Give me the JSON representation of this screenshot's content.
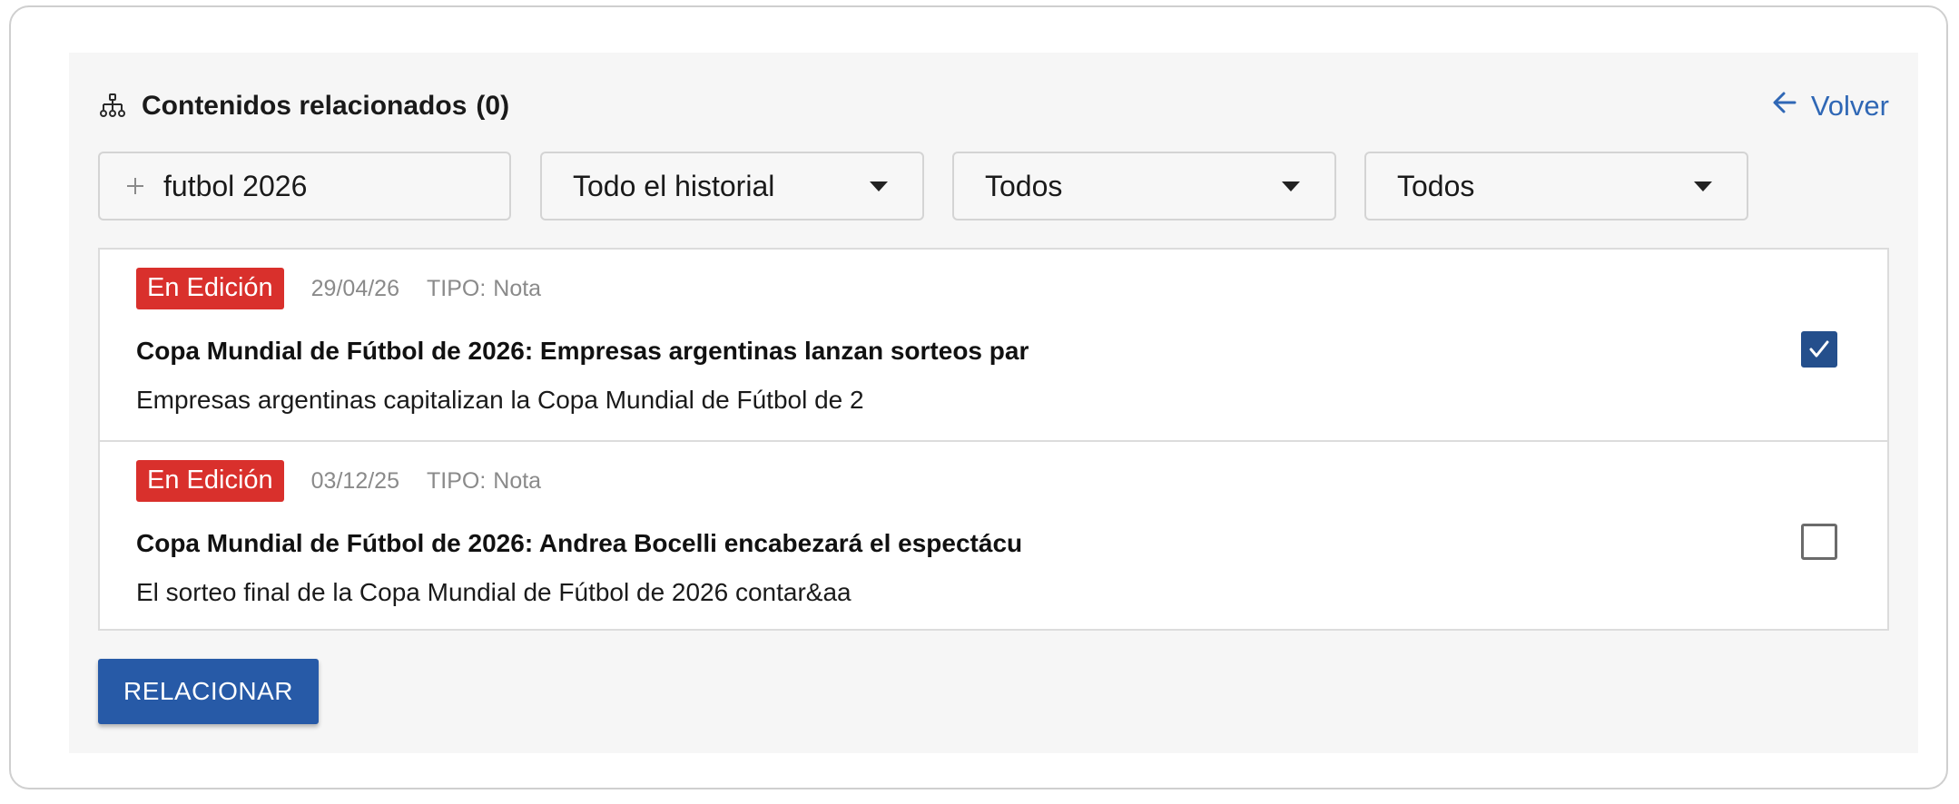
{
  "header": {
    "title": "Contenidos relacionados",
    "count": "(0)",
    "back_label": "Volver"
  },
  "filters": {
    "search_value": "futbol 2026",
    "history_value": "Todo el historial",
    "status_value": "Todos",
    "type_value": "Todos"
  },
  "results": [
    {
      "status": "En Edición",
      "date": "29/04/26",
      "type_label": "TIPO:",
      "type_value": "Nota",
      "title": "Copa Mundial de Fútbol de 2026: Empresas argentinas lanzan sorteos par",
      "summary": "Empresas argentinas capitalizan la Copa Mundial de Fútbol de 2",
      "selected": true
    },
    {
      "status": "En Edición",
      "date": "03/12/25",
      "type_label": "TIPO:",
      "type_value": "Nota",
      "title": "Copa Mundial de Fútbol de 2026: Andrea Bocelli encabezará el espectácu",
      "summary": "El sorteo final de la Copa Mundial de Fútbol de 2026 contar&aa",
      "selected": false
    }
  ],
  "actions": {
    "relate_label": "RELACIONAR"
  },
  "colors": {
    "accent": "#2f67b5",
    "button": "#275aa7",
    "status_badge": "#d9302c",
    "checkbox_checked": "#244f8c"
  },
  "icons": {
    "header": "sitemap-icon",
    "back": "arrow-left-icon",
    "search": "plus-icon",
    "dropdown": "caret-down-icon",
    "check": "checkmark-icon"
  }
}
